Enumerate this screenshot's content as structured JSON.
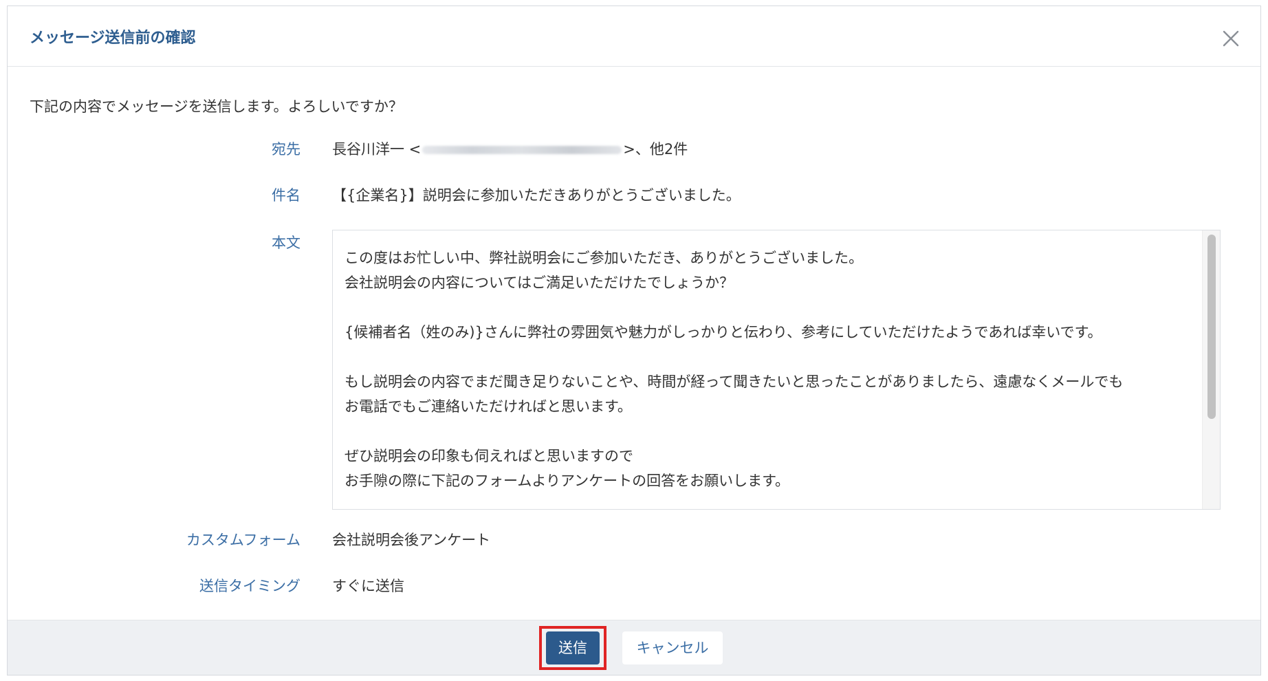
{
  "dialog": {
    "title": "メッセージ送信前の確認",
    "close_icon": "close-icon",
    "intro": "下記の内容でメッセージを送信します。よろしいですか？"
  },
  "fields": {
    "to": {
      "label": "宛先",
      "value_prefix": "長谷川洋一 <",
      "value_suffix": ">、他2件"
    },
    "subject": {
      "label": "件名",
      "value": "【{企業名}】説明会に参加いただきありがとうございました。"
    },
    "body": {
      "label": "本文",
      "lines": [
        "この度はお忙しい中、弊社説明会にご参加いただき、ありがとうございました。",
        "会社説明会の内容についてはご満足いただけたでしょうか？",
        "",
        "{候補者名（姓のみ)}さんに弊社の雰囲気や魅力がしっかりと伝わり、参考にしていただけたようであれば幸いです。",
        "",
        "もし説明会の内容でまだ聞き足りないことや、時間が経って聞きたいと思ったことがありましたら、遠慮なくメールでも",
        "お電話でもご連絡いただければと思います。",
        "",
        "ぜひ説明会の印象も伺えればと思いますので",
        "お手隙の際に下記のフォームよりアンケートの回答をお願いします。"
      ]
    },
    "custom_form": {
      "label": "カスタムフォーム",
      "value": "会社説明会後アンケート"
    },
    "timing": {
      "label": "送信タイミング",
      "value": "すぐに送信"
    }
  },
  "footer": {
    "send_label": "送信",
    "cancel_label": "キャンセル"
  },
  "colors": {
    "title": "#2d5d8f",
    "label": "#3b6ea5",
    "primary_button": "#2c5a8c",
    "highlight": "#e02424",
    "footer_bg": "#eef0f3"
  }
}
